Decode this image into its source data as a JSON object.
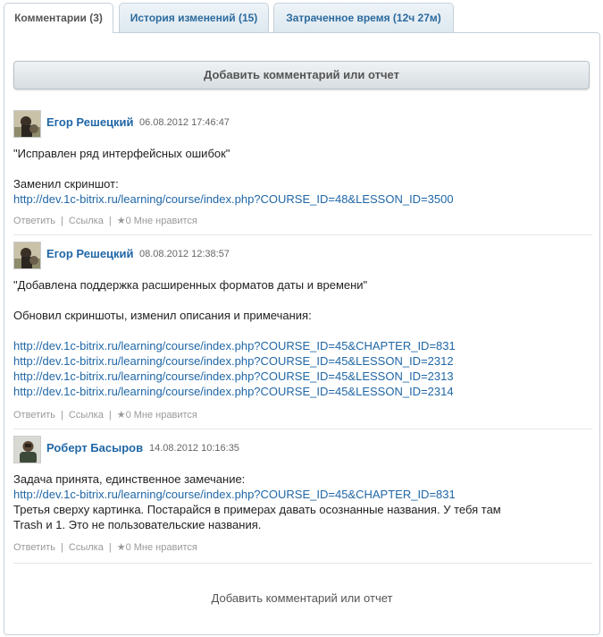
{
  "tabs": [
    {
      "label": "Комментарии (3)"
    },
    {
      "label": "История изменений (15)"
    },
    {
      "label": "Затраченное время (12ч 27м)"
    }
  ],
  "add_button_label": "Добавить комментарий или отчет",
  "bottom_add_label": "Добавить комментарий или отчет",
  "comments": [
    {
      "author": "Егор Решецкий",
      "date": "06.08.2012 17:46:47",
      "lines": [
        "\"Исправлен ряд интерфейсных ошибок\"",
        "Заменил скриншот:"
      ],
      "links": [
        "http://dev.1c-bitrix.ru/learning/course/index.php?COURSE_ID=48&LESSON_ID=3500"
      ],
      "actions": {
        "reply": "Ответить",
        "link": "Ссылка",
        "like": "0 Мне нравится"
      }
    },
    {
      "author": "Егор Решецкий",
      "date": "08.08.2012 12:38:57",
      "lines": [
        "\"Добавлена поддержка расширенных форматов даты и времени\"",
        "Обновил скриншоты, изменил описания и примечания:"
      ],
      "links": [
        "http://dev.1c-bitrix.ru/learning/course/index.php?COURSE_ID=45&CHAPTER_ID=831",
        "http://dev.1c-bitrix.ru/learning/course/index.php?COURSE_ID=45&LESSON_ID=2312",
        "http://dev.1c-bitrix.ru/learning/course/index.php?COURSE_ID=45&LESSON_ID=2313",
        "http://dev.1c-bitrix.ru/learning/course/index.php?COURSE_ID=45&LESSON_ID=2314"
      ],
      "actions": {
        "reply": "Ответить",
        "link": "Ссылка",
        "like": "0 Мне нравится"
      }
    },
    {
      "author": "Роберт Басыров",
      "date": "14.08.2012 10:16:35",
      "lines": [
        "Задача принята, единственное замечание:",
        "Третья сверху картинка. Постарайся в примерах давать осознанные названия. У тебя там",
        "Trash и 1. Это не пользовательские названия."
      ],
      "links": [
        "http://dev.1c-bitrix.ru/learning/course/index.php?COURSE_ID=45&CHAPTER_ID=831"
      ],
      "actions": {
        "reply": "Ответить",
        "link": "Ссылка",
        "like": "0 Мне нравится"
      }
    }
  ]
}
